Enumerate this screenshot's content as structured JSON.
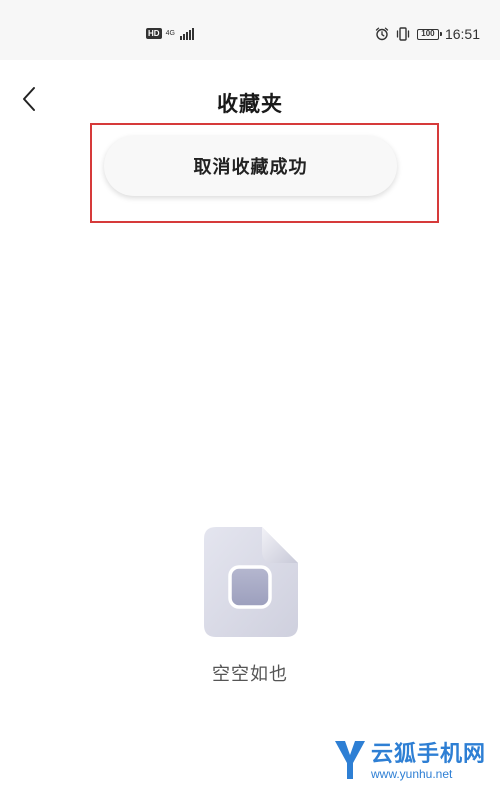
{
  "status_bar": {
    "hd_label": "HD",
    "network_type": "4G",
    "battery_level": "100",
    "time": "16:51"
  },
  "header": {
    "title": "收藏夹"
  },
  "toast": {
    "message": "取消收藏成功"
  },
  "empty_state": {
    "text": "空空如也"
  },
  "watermark": {
    "name": "云狐手机网",
    "url": "www.yunhu.net"
  },
  "colors": {
    "highlight_border": "#d63a3a",
    "watermark": "#2e7fd4"
  }
}
